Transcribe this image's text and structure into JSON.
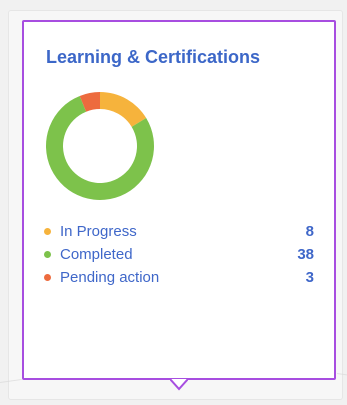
{
  "widget": {
    "title": "Learning & Certifications",
    "items": [
      {
        "label": "In Progress",
        "value": "8",
        "color": "#f6b33c"
      },
      {
        "label": "Completed",
        "value": "38",
        "color": "#7dc24b"
      },
      {
        "label": "Pending action",
        "value": "3",
        "color": "#ed6b3e"
      }
    ],
    "border_color": "#a74ee0",
    "text_color": "#3f67c9"
  },
  "chart_data": {
    "type": "pie",
    "categories": [
      "In Progress",
      "Completed",
      "Pending action"
    ],
    "values": [
      8,
      38,
      3
    ],
    "colors": [
      "#f6b33c",
      "#7dc24b",
      "#ed6b3e"
    ],
    "title": "Learning & Certifications",
    "legend_position": "bottom"
  }
}
